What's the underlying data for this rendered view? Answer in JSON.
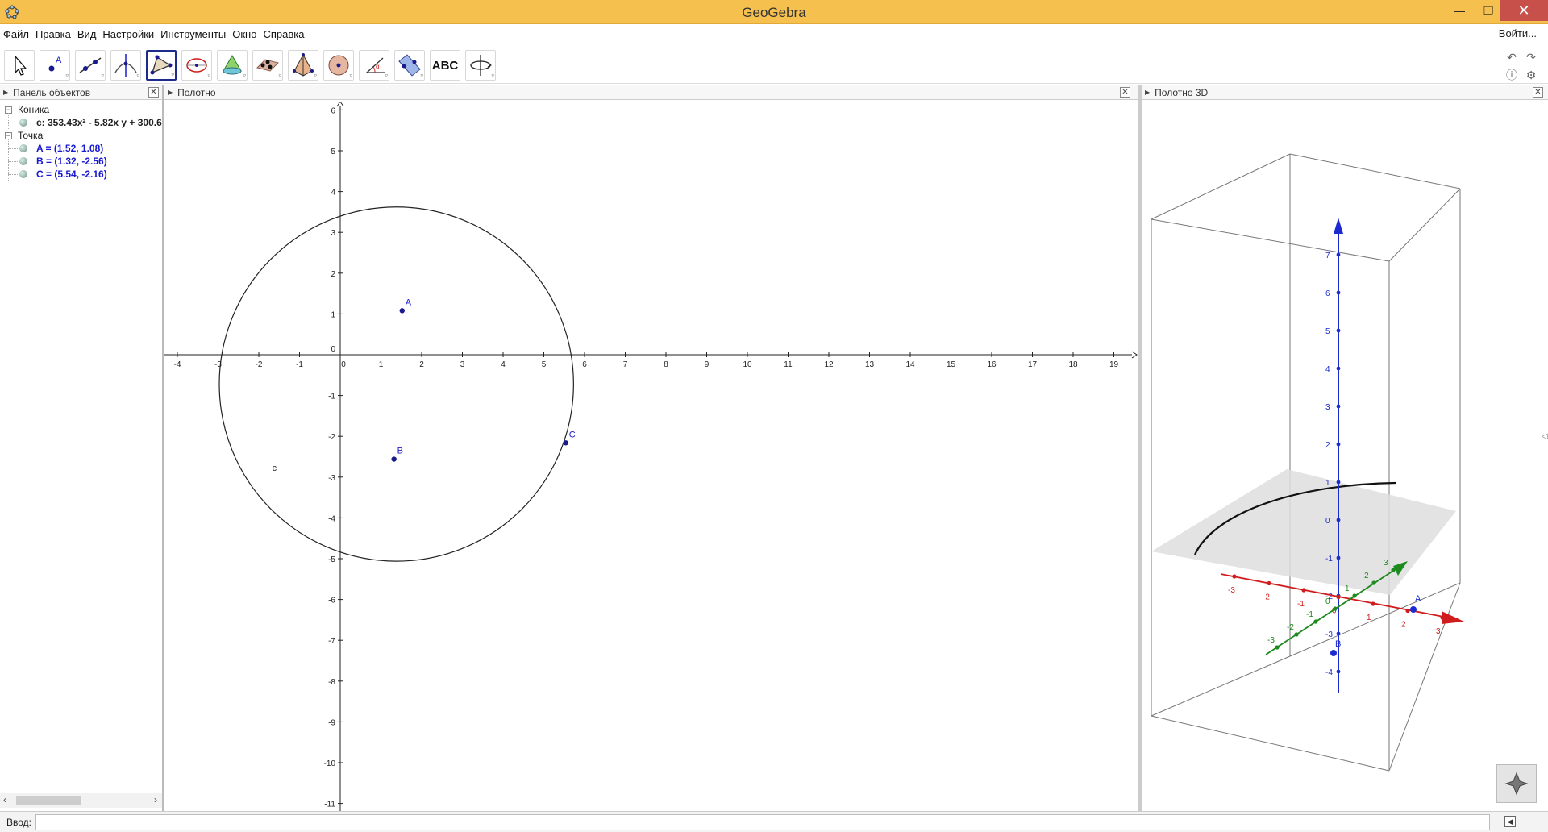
{
  "window": {
    "title": "GeoGebra"
  },
  "menu": {
    "items": [
      "Файл",
      "Правка",
      "Вид",
      "Настройки",
      "Инструменты",
      "Окно",
      "Справка"
    ],
    "login": "Войти..."
  },
  "toolbar": {
    "tools": [
      {
        "icon": "move-arrow-icon"
      },
      {
        "icon": "point-icon"
      },
      {
        "icon": "line-icon"
      },
      {
        "icon": "perpendicular-icon"
      },
      {
        "icon": "polygon-icon",
        "selected": true
      },
      {
        "icon": "circle-ellipse-icon"
      },
      {
        "icon": "cone-icon"
      },
      {
        "icon": "plane-points-icon"
      },
      {
        "icon": "pyramid-icon"
      },
      {
        "icon": "sphere-icon"
      },
      {
        "icon": "angle-icon"
      },
      {
        "icon": "reflect-plane-icon"
      },
      {
        "icon": "text-icon",
        "label": "ABC"
      },
      {
        "icon": "rotate-view-icon"
      }
    ]
  },
  "algebra": {
    "title": "Панель объектов",
    "groups": [
      {
        "name": "Коника",
        "items": [
          {
            "text": "c: 353.43x² - 5.82x y + 300.6",
            "color": "#000000"
          }
        ]
      },
      {
        "name": "Точка",
        "items": [
          {
            "text": "A = (1.52, 1.08)",
            "color": "#1a1ad0"
          },
          {
            "text": "B = (1.32, -2.56)",
            "color": "#1a1ad0"
          },
          {
            "text": "C = (5.54, -2.16)",
            "color": "#1a1ad0"
          }
        ]
      }
    ]
  },
  "graphics": {
    "title": "Полотно",
    "x_ticks": [
      -4,
      -3,
      -2,
      -1,
      0,
      1,
      2,
      3,
      4,
      5,
      6,
      7,
      8,
      9,
      10,
      11,
      12,
      13,
      14,
      15,
      16,
      17,
      18,
      19
    ],
    "y_ticks": [
      6,
      5,
      4,
      3,
      2,
      1,
      0,
      -1,
      -2,
      -3,
      -4,
      -5,
      -6,
      -7,
      -8,
      -9,
      -10,
      -11
    ],
    "points": [
      {
        "name": "A",
        "x": 1.52,
        "y": 1.08
      },
      {
        "name": "B",
        "x": 1.32,
        "y": -2.56
      },
      {
        "name": "C",
        "x": 5.54,
        "y": -2.16
      }
    ],
    "conic": {
      "name": "c",
      "cx": 1.38,
      "cy": -0.72,
      "r": 4.35
    }
  },
  "graphics3d": {
    "title": "Полотно 3D",
    "z_ticks": [
      "7",
      "6",
      "5",
      "4",
      "3",
      "2",
      "1",
      "0",
      "-1",
      "-2",
      "-3",
      "-4"
    ],
    "x_ticks": [
      "-3",
      "-2",
      "-1",
      "0",
      "1",
      "2",
      "3"
    ],
    "y_ticks": [
      "-3",
      "-2",
      "-1",
      "0",
      "1",
      "2",
      "3"
    ],
    "point_labels": [
      "A",
      "B"
    ]
  },
  "input": {
    "label": "Ввод:",
    "value": "",
    "placeholder": ""
  },
  "colors": {
    "titlebar": "#f5c04e",
    "point": "#1a1a8c",
    "axis_x3d": "#d01c1c",
    "axis_y3d": "#1d8a1d",
    "axis_z3d": "#1c2bd0"
  }
}
